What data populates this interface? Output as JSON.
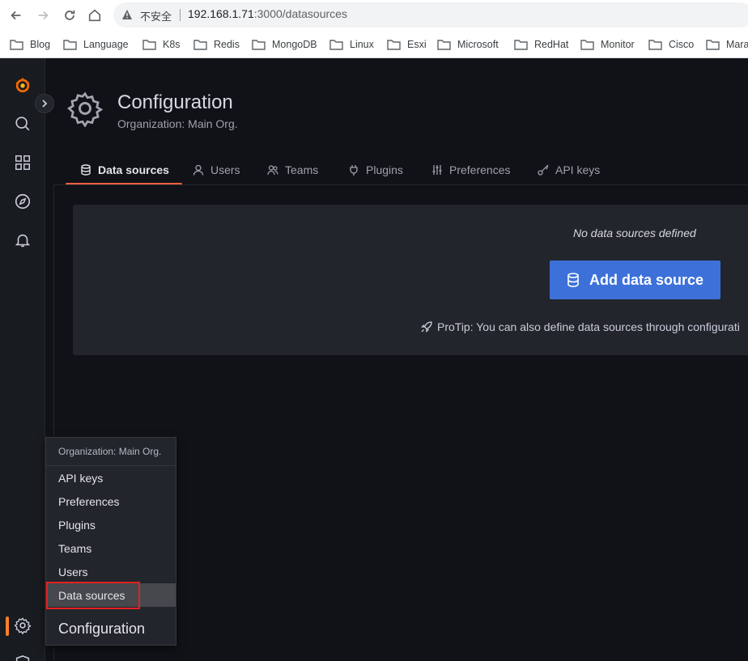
{
  "browser": {
    "insecure_label": "不安全",
    "url_host": "192.168.1.71",
    "url_rest": ":3000/datasources",
    "bookmarks": [
      {
        "label": "Blog"
      },
      {
        "label": "Language"
      },
      {
        "label": "K8s"
      },
      {
        "label": "Redis"
      },
      {
        "label": "MongoDB"
      },
      {
        "label": "Linux"
      },
      {
        "label": "Esxi"
      },
      {
        "label": "Microsoft"
      },
      {
        "label": "RedHat"
      },
      {
        "label": "Monitor"
      },
      {
        "label": "Cisco"
      },
      {
        "label": "Mara"
      }
    ]
  },
  "sidemenu": {
    "icons": [
      "grafana-logo-icon",
      "search-icon",
      "dashboards-icon",
      "explore-icon",
      "alerting-icon",
      "configuration-icon",
      "server-admin-icon"
    ],
    "accent_color": "#ff7f2a"
  },
  "header": {
    "title": "Configuration",
    "subtitle": "Organization: Main Org."
  },
  "tabs": [
    {
      "label": "Data sources",
      "icon": "database-icon",
      "active": true
    },
    {
      "label": "Users",
      "icon": "user-icon"
    },
    {
      "label": "Teams",
      "icon": "users-icon"
    },
    {
      "label": "Plugins",
      "icon": "plug-icon"
    },
    {
      "label": "Preferences",
      "icon": "sliders-icon"
    },
    {
      "label": "API keys",
      "icon": "key-icon"
    }
  ],
  "empty_state": {
    "title": "No data sources defined",
    "button_label": "Add data source",
    "button_color": "#3d71d9",
    "protip": "ProTip: You can also define data sources through configurati"
  },
  "dropdown": {
    "header": "Organization: Main Org.",
    "items": [
      "API keys",
      "Preferences",
      "Plugins",
      "Teams",
      "Users",
      "Data sources"
    ],
    "active_item": "Data sources",
    "footer": "Configuration",
    "highlight_color": "#e32121"
  }
}
